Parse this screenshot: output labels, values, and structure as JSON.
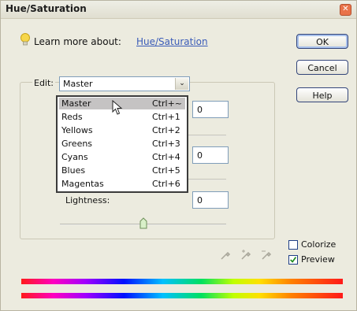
{
  "window": {
    "title": "Hue/Saturation",
    "close_glyph": "✕"
  },
  "learn": {
    "label": "Learn more about:",
    "link": "Hue/Saturation"
  },
  "buttons": {
    "ok": "OK",
    "cancel": "Cancel",
    "help": "Help"
  },
  "edit": {
    "label": "Edit:",
    "selected": "Master",
    "arrow_glyph": "⌄",
    "options": [
      {
        "label": "Master",
        "shortcut": "Ctrl+~"
      },
      {
        "label": "Reds",
        "shortcut": "Ctrl+1"
      },
      {
        "label": "Yellows",
        "shortcut": "Ctrl+2"
      },
      {
        "label": "Greens",
        "shortcut": "Ctrl+3"
      },
      {
        "label": "Cyans",
        "shortcut": "Ctrl+4"
      },
      {
        "label": "Blues",
        "shortcut": "Ctrl+5"
      },
      {
        "label": "Magentas",
        "shortcut": "Ctrl+6"
      }
    ]
  },
  "values": {
    "hue": "0",
    "saturation": "0",
    "lightness": "0"
  },
  "lightness_label": "Lightness:",
  "colorize": {
    "label": "Colorize",
    "checked": false
  },
  "preview": {
    "label": "Preview",
    "checked": true
  },
  "colors": {
    "accent": "#3a5bb8",
    "menu_highlight": "#c5c3c3"
  },
  "icons": [
    "lightbulb-icon",
    "close-icon",
    "cursor-arrow-icon",
    "eyedropper-icon",
    "eyedropper-plus-icon",
    "eyedropper-minus-icon",
    "slider-thumb-icon"
  ]
}
